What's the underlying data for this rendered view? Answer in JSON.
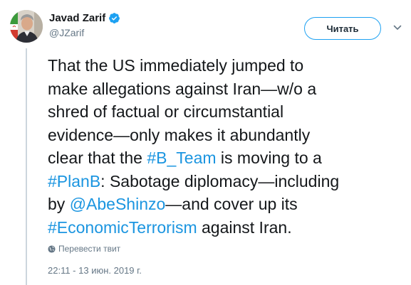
{
  "author": {
    "display_name": "Javad Zarif",
    "handle": "@JZarif",
    "verified": true,
    "avatar": "profile-photo"
  },
  "actions": {
    "follow_label": "Читать",
    "more_icon": "chevron-down-icon"
  },
  "tweet": {
    "lines": [
      [
        {
          "text": "That the US immediately jumped to"
        }
      ],
      [
        {
          "text": "make allegations against Iran—w/o a"
        }
      ],
      [
        {
          "text": "shred of factual or circumstantial"
        }
      ],
      [
        {
          "text": "evidence—only makes it abundantly"
        }
      ],
      [
        {
          "text": "clear that the "
        },
        {
          "text": "#B_Team",
          "link": true
        },
        {
          "text": " is moving to a"
        }
      ],
      [
        {
          "text": "#PlanB",
          "link": true
        },
        {
          "text": ": Sabotage diplomacy—including"
        }
      ],
      [
        {
          "text": "by "
        },
        {
          "text": "@AbeShinzo",
          "link": true
        },
        {
          "text": "—and cover up its"
        }
      ],
      [
        {
          "text": "#EconomicTerrorism",
          "link": true
        },
        {
          "text": " against Iran."
        }
      ]
    ]
  },
  "translate": {
    "label": "Перевести твит",
    "icon": "globe-icon"
  },
  "timestamp": "22:11 - 13 июн. 2019 г.",
  "colors": {
    "link": "#1b95e0",
    "follow_border": "#1da1f2",
    "secondary_text": "#657786",
    "thread_line": "#ccd6dd"
  }
}
